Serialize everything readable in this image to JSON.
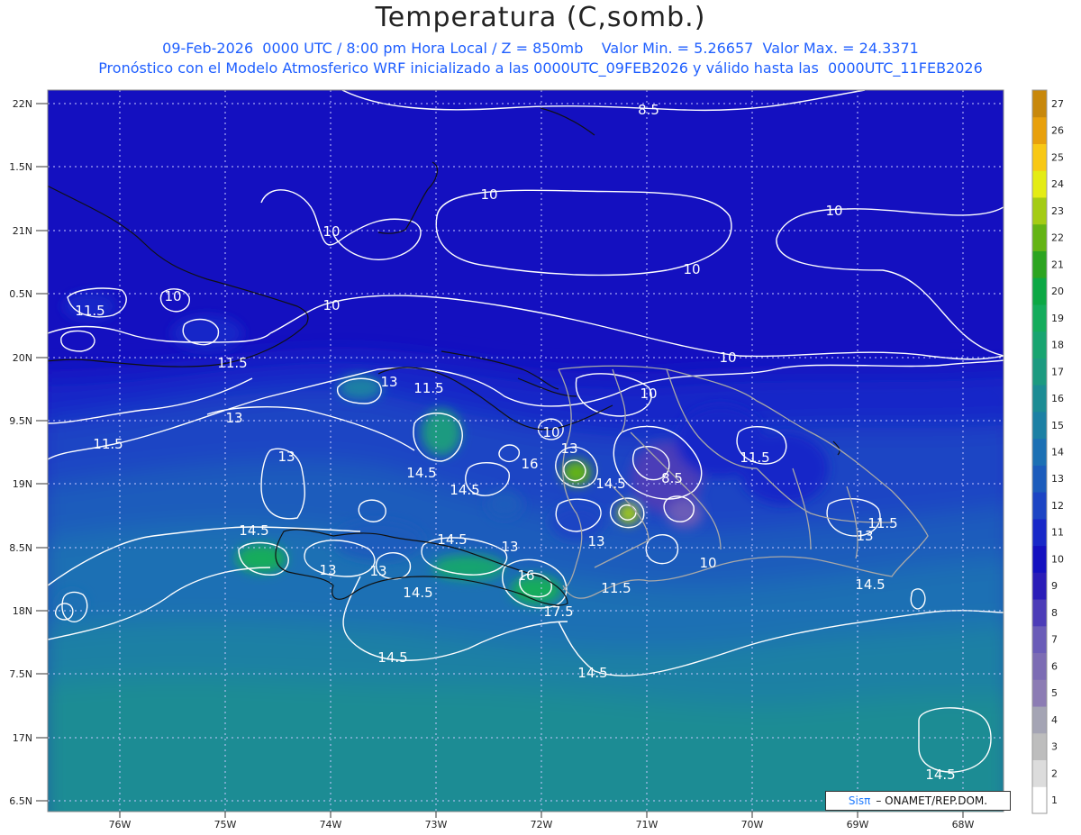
{
  "title": "Temperatura (C,somb.)",
  "subtitle_line1": "09-Feb-2026  0000 UTC / 8:00 pm Hora Local / Z = 850mb    Valor Min. = 5.26657  Valor Max. = 24.3371",
  "subtitle_line2": "Pronóstico con el Modelo Atmosferico WRF inicializado a las 0000UTC_09FEB2026 y válido hasta las  0000UTC_11FEB2026",
  "lat_labels": [
    "22N",
    "1.5N",
    "21N",
    "0.5N",
    "20N",
    "9.5N",
    "19N",
    "8.5N",
    "18N",
    "7.5N",
    "17N",
    "6.5N"
  ],
  "lon_labels": [
    "76W",
    "75W",
    "74W",
    "73W",
    "72W",
    "71W",
    "70W",
    "69W",
    "68W"
  ],
  "colorbar": {
    "labels": [
      "1",
      "2",
      "3",
      "4",
      "5",
      "6",
      "7",
      "8",
      "9",
      "10",
      "11",
      "12",
      "13",
      "14",
      "15",
      "16",
      "17",
      "18",
      "19",
      "20",
      "21",
      "22",
      "23",
      "24",
      "25",
      "26",
      "27"
    ],
    "colors": [
      "#ffffff",
      "#dcdcdc",
      "#bdbdbd",
      "#a4a4b4",
      "#8c7cb4",
      "#7c6cb4",
      "#6a5cb8",
      "#4c3cb8",
      "#2a1cb8",
      "#1410c0",
      "#1828c8",
      "#1c44c4",
      "#1c5cbc",
      "#1c70b4",
      "#1c80a4",
      "#1c8c94",
      "#1c9a80",
      "#18a470",
      "#14ac5c",
      "#0ca844",
      "#2ca420",
      "#64b414",
      "#a4cc14",
      "#e4ec14",
      "#f8c814",
      "#e8a00c",
      "#c8880c"
    ]
  },
  "contour_labels": [
    "8.5",
    "10",
    "10",
    "10",
    "10",
    "10",
    "10",
    "10",
    "10",
    "10",
    "11.5",
    "11.5",
    "11.5",
    "11.5",
    "11.5",
    "11.5",
    "11.5",
    "13",
    "13",
    "13",
    "13",
    "13",
    "13",
    "13",
    "13",
    "13",
    "14.5",
    "14.5",
    "14.5",
    "14.5",
    "14.5",
    "14.5",
    "14.5",
    "14.5",
    "14.5",
    "14.5",
    "16",
    "16",
    "17.5",
    "8.5",
    "10"
  ],
  "credit_brand": "Sisπ",
  "credit_text": "– ONAMET/REP.DOM."
}
